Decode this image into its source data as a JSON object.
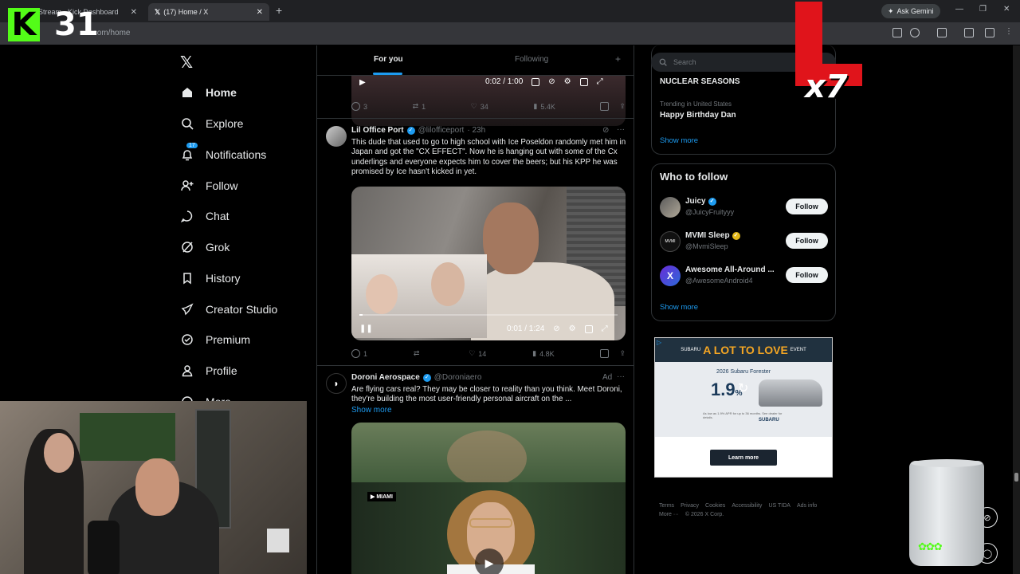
{
  "browser": {
    "tabs": [
      {
        "title": "Stream - Kick Dashboard",
        "close": "✕"
      },
      {
        "title": "(17) Home / X",
        "close": "✕"
      }
    ],
    "new_tab": "+",
    "ask_gemini": "Ask Gemini",
    "url": ".com/home",
    "window_controls": [
      "—",
      "❐",
      "✕"
    ]
  },
  "overlay": {
    "kick_logo": "K",
    "kick_count": "31",
    "l_multiplier": "x7"
  },
  "nav": {
    "logo": "𝕏",
    "notifications_badge": "17",
    "items": [
      {
        "label": "Home",
        "icon": "home-icon"
      },
      {
        "label": "Explore",
        "icon": "search-icon"
      },
      {
        "label": "Notifications",
        "icon": "bell-icon"
      },
      {
        "label": "Follow",
        "icon": "person-add-icon"
      },
      {
        "label": "Chat",
        "icon": "chat-icon"
      },
      {
        "label": "Grok",
        "icon": "grok-icon"
      },
      {
        "label": "History",
        "icon": "bookmark-icon"
      },
      {
        "label": "Creator Studio",
        "icon": "rocket-icon"
      },
      {
        "label": "Premium",
        "icon": "verified-icon"
      },
      {
        "label": "Profile",
        "icon": "person-icon"
      },
      {
        "label": "More",
        "icon": "more-icon"
      }
    ]
  },
  "timeline": {
    "tabs": {
      "for_you": "For you",
      "following": "Following",
      "add": "+"
    },
    "post0": {
      "video_time": "0:02 / 1:00",
      "video_progress": 0.03,
      "replies": "3",
      "reposts": "1",
      "likes": "34",
      "views": "5.4K"
    },
    "post1": {
      "name": "Lil Office Port",
      "handle": "@lilofficeport",
      "time": "· 23h",
      "text": "This dude that used to go to high school with Ice Poseldon randomly met him in Japan and got the \"CX EFFECT\". Now he is hanging out with some of the Cx underlings and everyone expects him to cover the beers; but his KPP he was promised by Ice hasn't kicked in yet.",
      "video_time": "0:01 / 1:24",
      "video_progress": 0.012,
      "replies": "1",
      "reposts": "",
      "likes": "14",
      "views": "4.8K"
    },
    "post2": {
      "name": "Doroni Aerospace",
      "handle": "@Doroniaero",
      "ad_label": "Ad",
      "text": "Are flying cars real? They may be closer to reality than you think. Meet Doroni, they're building the most user-friendly personal aircraft on the ...",
      "show_more": "Show more",
      "video_tag": "▶ MIAMI"
    }
  },
  "sidebar": {
    "search_placeholder": "Search",
    "trends": [
      {
        "meta": "",
        "title": "NUCLEAR SEASONS"
      },
      {
        "meta": "Trending in United States",
        "title": "Happy Birthday Dan"
      }
    ],
    "show_more": "Show more",
    "who_to_follow": {
      "title": "Who to follow",
      "accounts": [
        {
          "name": "Juicy",
          "handle": "@JuicyFruityyy",
          "button": "Follow"
        },
        {
          "name": "MVMI Sleep",
          "handle": "@MvmiSleep",
          "button": "Follow"
        },
        {
          "name": "Awesome All-Around ...",
          "handle": "@AwesomeAndroid4",
          "button": "Follow"
        }
      ],
      "show_more": "Show more"
    },
    "ad": {
      "headline_small": "SUBARU",
      "headline": "A LOT TO LOVE",
      "headline_tail": "EVENT",
      "model": "2026 Subaru Forester",
      "rate": "1.9",
      "rate_suffix": "%",
      "fine_print": "As low as 1.9% APR for up to 36 months. See dealer for details.",
      "brand": "SUBARU",
      "cta": "Learn more"
    },
    "footer": [
      "Terms",
      "Privacy",
      "Cookies",
      "Accessibility",
      "US TIDA",
      "Ads info",
      "More ···",
      "© 2026 X Corp."
    ]
  },
  "colors": {
    "accent": "#1d9bf0",
    "kick_green": "#53fc18",
    "l_red": "#e0141b"
  }
}
